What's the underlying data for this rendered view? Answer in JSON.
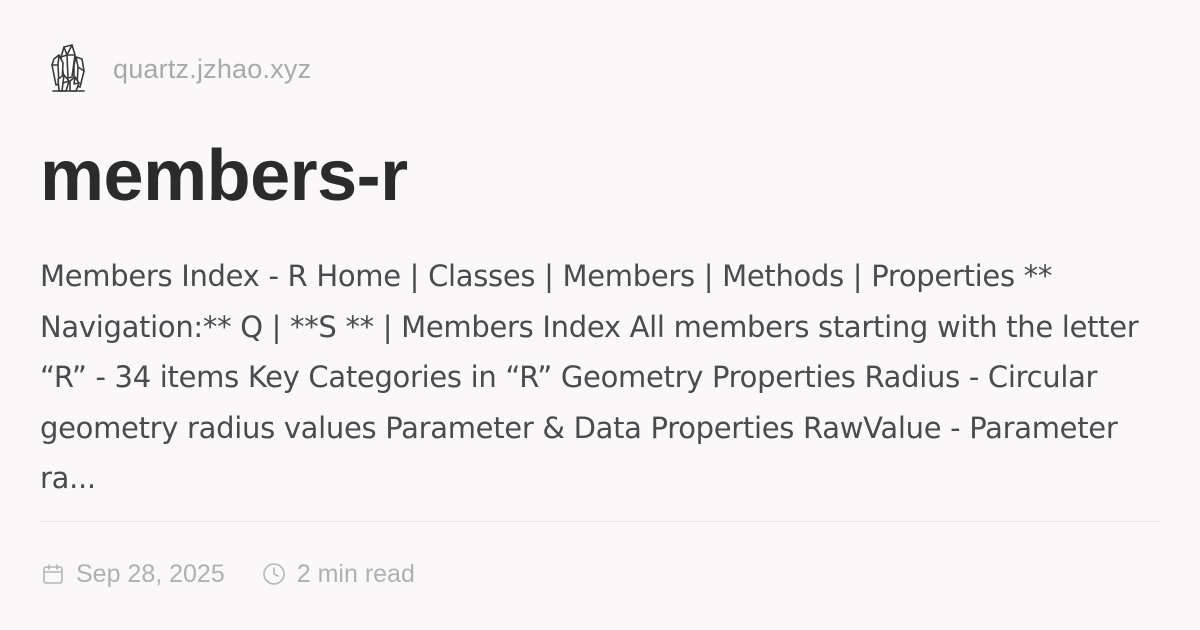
{
  "site": {
    "logo_icon": "crystal-cluster-icon",
    "url": "quartz.jzhao.xyz"
  },
  "page": {
    "title": "members-r",
    "description": "Members Index - R Home | Classes | Members | Methods | Properties ** Navigation:** Q | **S ** | Members Index All members starting with the letter “R” - 34 items Key Categories in “R” Geometry Properties Radius - Circular geometry radius values Parameter & Data Properties RawValue - Parameter ra..."
  },
  "meta": {
    "date_icon": "calendar-icon",
    "date": "Sep 28, 2025",
    "read_time_icon": "clock-icon",
    "read_time": "2 min read"
  },
  "colors": {
    "background": "#faf8f8",
    "title": "#2b2b2b",
    "description": "#4a4a4f",
    "muted": "#b0b0b4"
  }
}
